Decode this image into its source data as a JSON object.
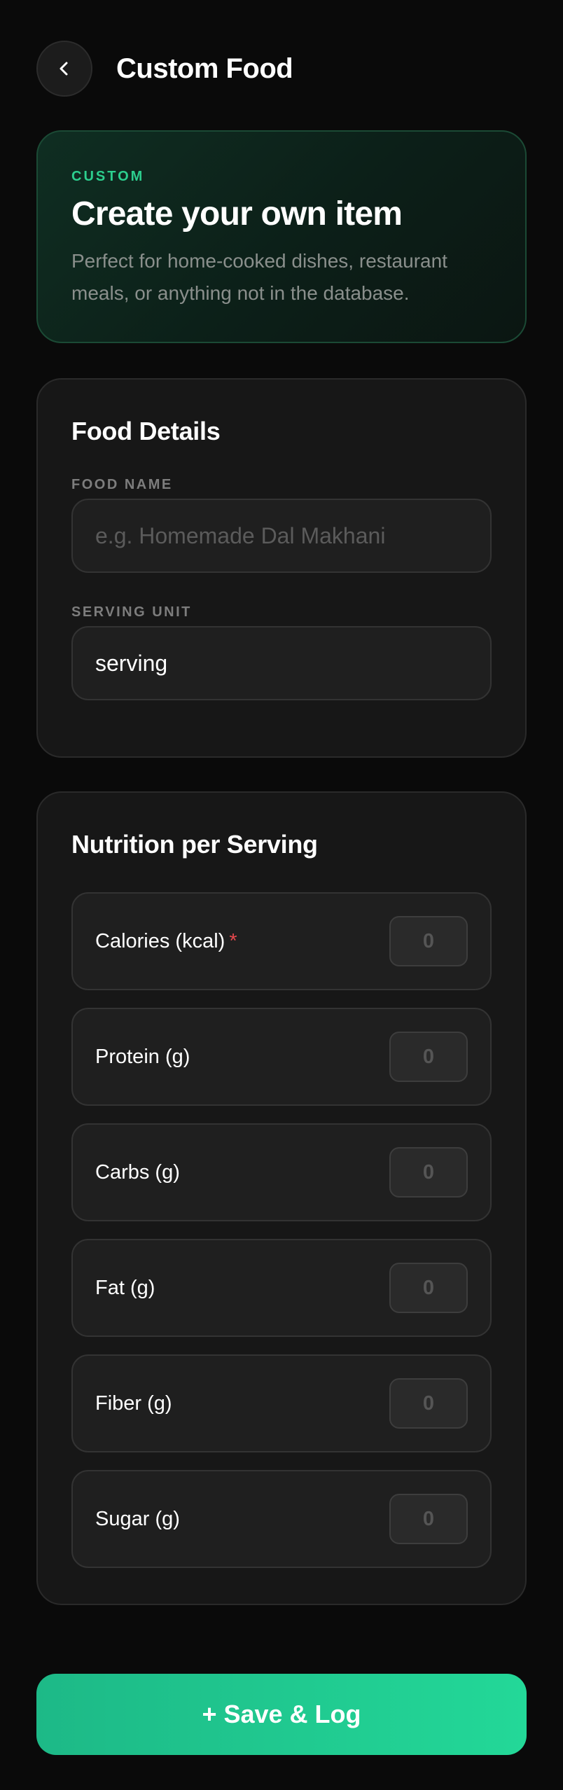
{
  "header": {
    "back_icon": "chevron-left-icon",
    "title": "Custom Food"
  },
  "hero": {
    "eyebrow": "CUSTOM",
    "title": "Create your own item",
    "description": "Perfect for home-cooked dishes, restaurant meals, or anything not in the database."
  },
  "details": {
    "title": "Food Details",
    "food_name": {
      "label": "FOOD NAME",
      "placeholder": "e.g. Homemade Dal Makhani",
      "value": ""
    },
    "serving_unit": {
      "label": "SERVING UNIT",
      "value": "serving"
    }
  },
  "nutrition": {
    "title": "Nutrition per Serving",
    "rows": [
      {
        "label": "Calories (kcal)",
        "required": "*",
        "placeholder": "0"
      },
      {
        "label": "Protein (g)",
        "placeholder": "0"
      },
      {
        "label": "Carbs (g)",
        "placeholder": "0"
      },
      {
        "label": "Fat (g)",
        "placeholder": "0"
      },
      {
        "label": "Fiber (g)",
        "placeholder": "0"
      },
      {
        "label": "Sugar (g)",
        "placeholder": "0"
      }
    ]
  },
  "actions": {
    "save_label": "+ Save & Log"
  },
  "colors": {
    "background": "#0a0a0a",
    "accent": "#23d898",
    "required": "#e5484d",
    "card": "#171717"
  }
}
